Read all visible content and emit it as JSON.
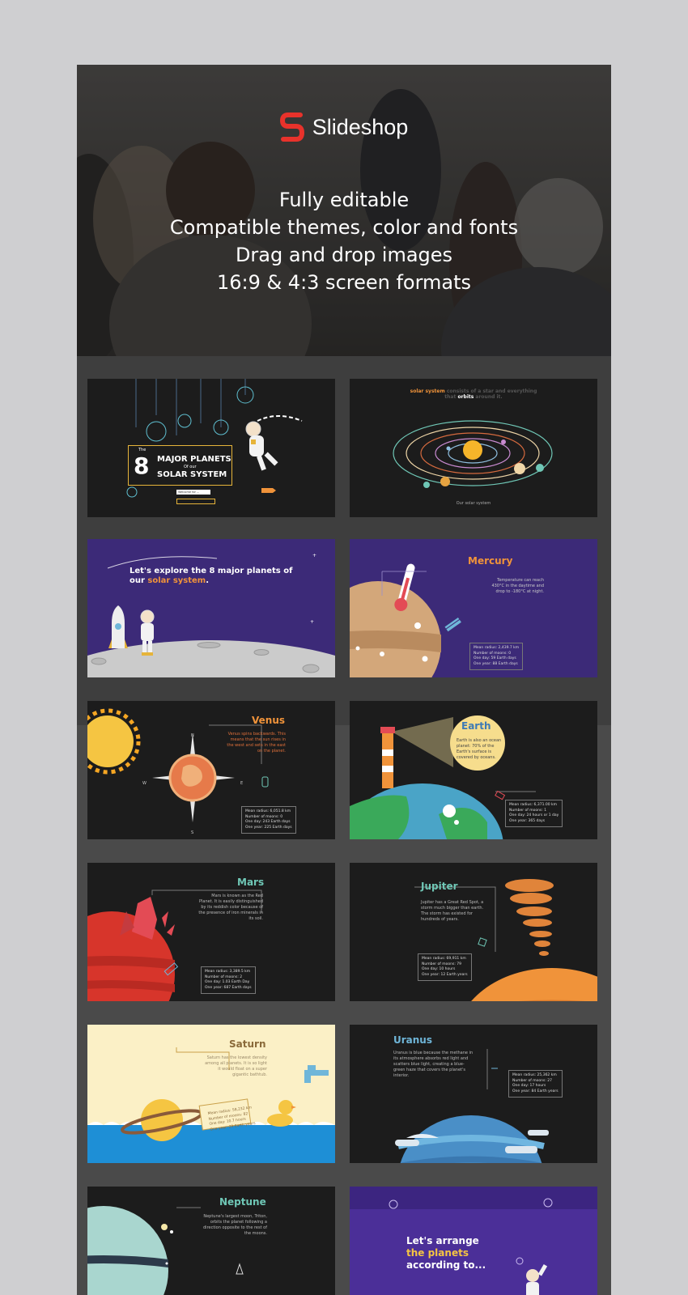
{
  "brand": {
    "name": "Slideshop"
  },
  "features": [
    "Fully editable",
    "Compatible themes, color and fonts",
    "Drag and drop images",
    "16:9 & 4:3 screen formats"
  ],
  "slides": {
    "s1": {
      "the": "The",
      "number": "8",
      "line1": "MAJOR PLANETS",
      "of": "Of our",
      "line2": "SOLAR SYSTEM",
      "welcome": "Welcome for ..."
    },
    "s2": {
      "t1": "solar system",
      "t2": "consists of a star and everything",
      "t3": "that",
      "t4": "orbits",
      "t5": "around it.",
      "caption": "Our solar system"
    },
    "s3": {
      "title1": "Let's explore the 8 major planets of",
      "title2a": "our ",
      "title2b": "solar system",
      "title2c": "."
    },
    "s4": {
      "title": "Mercury",
      "d1": "Temperature can reach",
      "d2": "430°C in the daytime and",
      "d3": "drop to -180°C at night.",
      "stats": [
        "Mean radius: 2,439.7 km",
        "Number of moons: 0",
        "One day: 59 Earth days",
        "One year: 88 Earth days"
      ]
    },
    "s5": {
      "title": "Venus",
      "d1": "Venus spins backwards. This",
      "d2": "means that the sun rises in",
      "d3": "the west and sets in the east",
      "d4": "on the planet.",
      "n": "N",
      "s": "S",
      "w": "W",
      "e": "E",
      "stats": [
        "Mean radius: 6,051.8 km",
        "Number of moons: 0",
        "One day: 243 Earth days",
        "One year: 225 Earth days"
      ]
    },
    "s6": {
      "title": "Earth",
      "d1": "Earth is also an ocean",
      "d2": "planet: 70% of the",
      "d3": "Earth's surface is",
      "d4": "covered by oceans.",
      "stats": [
        "Mean radius: 6,371.00 km",
        "Number of moons: 1",
        "One day: 24 hours or 1 day",
        "One year: 365 days"
      ]
    },
    "s7": {
      "title": "Mars",
      "d1": "Mars is known as the Red",
      "d2": "Planet. It is easily distinguished",
      "d3": "by its reddish color because of",
      "d4": "the presence of iron minerals in",
      "d5": "its soil.",
      "stats": [
        "Mean radius: 3,389.5 km",
        "Number of moons: 2",
        "One day: 1.03 Earth Day",
        "One year: 687 Earth days"
      ]
    },
    "s8": {
      "title": "Jupiter",
      "d1": "Jupiter has a Great Red Spot, a",
      "d2": "storm much bigger than earth.",
      "d3": "The storm has existed for",
      "d4": "hundreds of years.",
      "stats": [
        "Mean radius: 69,911 km",
        "Number of moons: 79",
        "One day: 10 hours",
        "One year: 12 Earth years"
      ]
    },
    "s9": {
      "title": "Saturn",
      "d1": "Saturn has the lowest density",
      "d2": "among all planets. It is so light",
      "d3": "it would float on a super",
      "d4": "gigantic bathtub.",
      "stats": [
        "Mean radius: 58,232 km",
        "Number of moons: 82",
        "One day: 10.7 hours",
        "One year: 29 Earth years"
      ]
    },
    "s10": {
      "title": "Uranus",
      "d1": "Uranus is blue because the methane in",
      "d2": "its atmosphere absorbs red light and",
      "d3": "scatters blue light, creating a blue-",
      "d4": "green haze that covers the planet's",
      "d5": "interior.",
      "stats": [
        "Mean radius: 25,362 km",
        "Number of moons: 27",
        "One day: 17 hours",
        "One year: 84 Earth years"
      ]
    },
    "s11": {
      "title": "Neptune",
      "d1": "Neptune's largest moon, Triton,",
      "d2": "orbits the planet following a",
      "d3": "direction opposite to the rest of",
      "d4": "the moons."
    },
    "s12": {
      "l1": "Let's arrange",
      "l2": "the planets",
      "l3": "according to..."
    }
  },
  "colors": {
    "brand_red": "#e8322b",
    "accent_orange": "#f0933a",
    "accent_teal": "#4fd3c4",
    "slide_purple": "#3c2a78"
  }
}
